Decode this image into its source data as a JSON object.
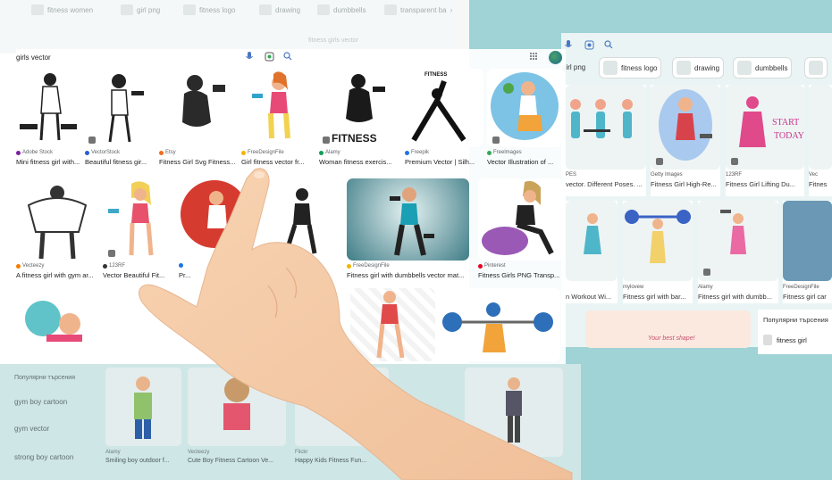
{
  "back_tabs": {
    "items": [
      "fitness women",
      "girl png",
      "fitness logo",
      "drawing",
      "dumbbells",
      "transparent ba"
    ]
  },
  "search": {
    "query": "girls vector",
    "ghost_query": "fitness girls vector"
  },
  "main_results": [
    {
      "source": "Adobe Stock",
      "caption": "Mini fitness girl with...",
      "dot": "#7b1fa2"
    },
    {
      "source": "VectorStock",
      "caption": "Beautiful fitness gir...",
      "dot": "#2a5bd7"
    },
    {
      "source": "Etsy",
      "caption": "Fitness Girl Svg Fitness...",
      "dot": "#f26a1b"
    },
    {
      "source": "FreeDesignFile",
      "caption": "Girl fitness vector fr...",
      "dot": "#f4b400"
    },
    {
      "source": "Alamy",
      "caption": "Woman fitness exercis...",
      "dot": "#0f9d58"
    },
    {
      "source": "Freepik",
      "caption": "Premium Vector | Silh...",
      "dot": "#1a73e8"
    },
    {
      "source": "Freelmages",
      "caption": "Vector Illustration of ...",
      "dot": "#34a853"
    },
    {
      "source": "Vecteezy",
      "caption": "A fitness girl with gym ar...",
      "dot": "#f57c00"
    },
    {
      "source": "123RF",
      "caption": "Vector Beautiful Fit...",
      "dot": "#333333"
    },
    {
      "source": "",
      "caption": "Pr...",
      "dot": "#1a73e8"
    },
    {
      "source": "",
      "caption": "Art, Ic...",
      "dot": "#ffffff"
    },
    {
      "source": "FreeDesignFile",
      "caption": "Fitness girl with dumbbells vector mat...",
      "dot": "#f4b400"
    },
    {
      "source": "Pinterest",
      "caption": "Fitness Girls PNG Transp...",
      "dot": "#e60023"
    }
  ],
  "overlay_banner": "FITNESS",
  "overlay_banner_2": "FITNESS",
  "right_panel": {
    "chips": [
      "girl png",
      "fitness logo",
      "drawing",
      "dumbbells"
    ],
    "row1": [
      {
        "source": "PES",
        "caption": "vector. Different Poses. ..."
      },
      {
        "source": "Getty Images",
        "caption": "Fitness Girl High-Re..."
      },
      {
        "source": "123RF",
        "caption": "Fitness Girl Lifting Du..."
      },
      {
        "source": "Vec",
        "caption": "Fitnes"
      }
    ],
    "row2": [
      {
        "source": "",
        "caption": "n Workout Wi..."
      },
      {
        "source": "mylovew",
        "caption": "Fitness girl with bar..."
      },
      {
        "source": "Alamy",
        "caption": "Fitness girl with dumbb..."
      },
      {
        "source": "FreeDesignFile",
        "caption": "Fitness girl car"
      }
    ],
    "start_today": [
      "START",
      "TODAY"
    ],
    "banner_text": "Your best shape!",
    "popular_title": "Популярни търсения",
    "popular_item": "fitness girl"
  },
  "bottom": {
    "popular_title": "Популярни търсения",
    "list": [
      "gym boy cartoon",
      "gym vector",
      "strong boy cartoon"
    ],
    "cards": [
      {
        "source": "Alamy",
        "caption": "Smiling boy outdoor f..."
      },
      {
        "source": "Vecteezy",
        "caption": "Cute Boy Fitness Cartoon Ve..."
      },
      {
        "source": "Flickr",
        "caption": "Happy Kids Fitness Fun..."
      }
    ]
  },
  "colors": {
    "teal": "#9fd3d6",
    "skin": "#f6c9a4",
    "accent_blue": "#4a77c4"
  }
}
